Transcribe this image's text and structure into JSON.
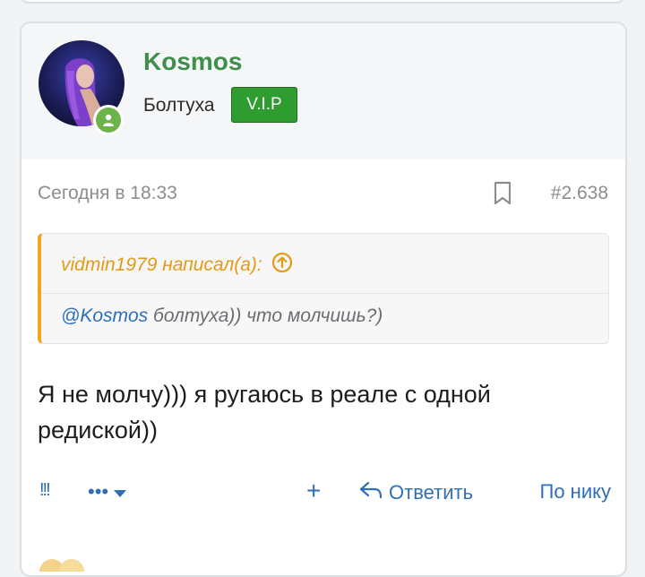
{
  "post": {
    "author": {
      "username": "Kosmos",
      "title": "Болтуха",
      "badge": "V.I.P",
      "avatar_icon": "avatar-photo",
      "status_icon": "online-user-icon"
    },
    "date": "Сегодня в 18:33",
    "number": "#2.638",
    "quote": {
      "header": "vidmin1979 написал(а):",
      "mention": "@Kosmos",
      "text": " болтуха)) что молчишь?)"
    },
    "body": "Я не молчу))) я ругаюсь в реале с одной редиской))",
    "actions": {
      "report": "!!!",
      "more": "•••",
      "add": "+",
      "reply": "Ответить",
      "quote_nick": "По нику"
    }
  },
  "colors": {
    "username": "#3e8f4a",
    "vip_badge": "#2e9c2e",
    "quote_accent": "#f2a51a",
    "link": "#2f6fb5"
  }
}
